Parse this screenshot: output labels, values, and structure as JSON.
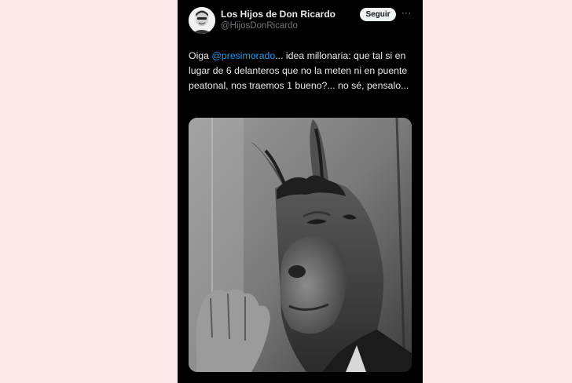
{
  "post": {
    "author_name": "Los Hijos de Don Ricardo",
    "author_handle": "@HijosDonRicardo",
    "follow_label": "Seguir",
    "more_icon": "more-horizontal-icon",
    "text_before_mention": "Oiga ",
    "mention": "@presimorado",
    "text_after_mention": "... idea millonaria: que tal si en lugar de 6 delanteros que no la meten ni en puente peatonal, nos traemos 1 bueno?... no sé, pensalo...",
    "media_description": "photo"
  },
  "colors": {
    "page_background": "#fde9ea",
    "post_background": "#000000",
    "text_primary": "#e7e9ea",
    "text_secondary": "#71767b",
    "link": "#1d9bf0",
    "follow_button_bg": "#eff3f4"
  }
}
